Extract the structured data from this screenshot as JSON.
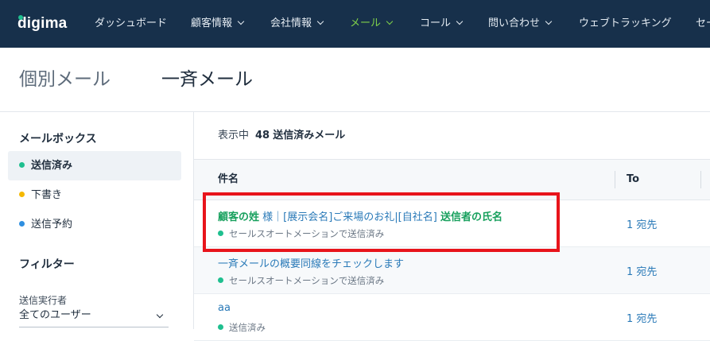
{
  "brand": {
    "logo": "digima",
    "accent": "#1fbf8f",
    "nav_bg": "#17304b"
  },
  "nav": {
    "items": [
      {
        "label": "ダッシュボード",
        "dropdown": false,
        "active": false
      },
      {
        "label": "顧客情報",
        "dropdown": true,
        "active": false
      },
      {
        "label": "会社情報",
        "dropdown": true,
        "active": false
      },
      {
        "label": "メール",
        "dropdown": true,
        "active": true
      },
      {
        "label": "コール",
        "dropdown": true,
        "active": false
      },
      {
        "label": "問い合わせ",
        "dropdown": true,
        "active": false
      },
      {
        "label": "ウェブトラッキング",
        "dropdown": false,
        "active": false
      },
      {
        "label": "セー",
        "dropdown": false,
        "active": false
      }
    ]
  },
  "tabs": [
    {
      "label": "個別メール",
      "active": false
    },
    {
      "label": "一斉メール",
      "active": true
    }
  ],
  "sidebar": {
    "mailbox_title": "メールボックス",
    "items": [
      {
        "label": "送信済み",
        "dot_color": "#1fbf8f",
        "active": true
      },
      {
        "label": "下書き",
        "dot_color": "#f5b800",
        "active": false
      },
      {
        "label": "送信予約",
        "dot_color": "#2f8fe0",
        "active": false
      }
    ],
    "filter_title": "フィルター",
    "sender_label": "送信実行者",
    "sender_value": "全てのユーザー"
  },
  "list": {
    "count_label": "表示中",
    "count": "48",
    "count_unit": "送信済みメール",
    "columns": {
      "subject": "件名",
      "to": "To"
    },
    "rows": [
      {
        "subject_parts": [
          {
            "text": "顧客の姓",
            "highlight": true
          },
          {
            "text": " 様｜[展示会名]ご来場のお礼|[自社名] ",
            "highlight": false
          },
          {
            "text": "送信者の氏名",
            "highlight": true
          }
        ],
        "status": "セールスオートメーションで送信済み",
        "to": "1 宛先"
      },
      {
        "subject_parts": [
          {
            "text": "一斉メールの概要同線をチェックします",
            "highlight": false
          }
        ],
        "status": "セールスオートメーションで送信済み",
        "to": "1 宛先"
      },
      {
        "subject_parts": [
          {
            "text": "aa",
            "highlight": false
          }
        ],
        "status": "送信済み",
        "to": "1 宛先"
      }
    ]
  },
  "annotation": {
    "color": "#e8141b"
  }
}
